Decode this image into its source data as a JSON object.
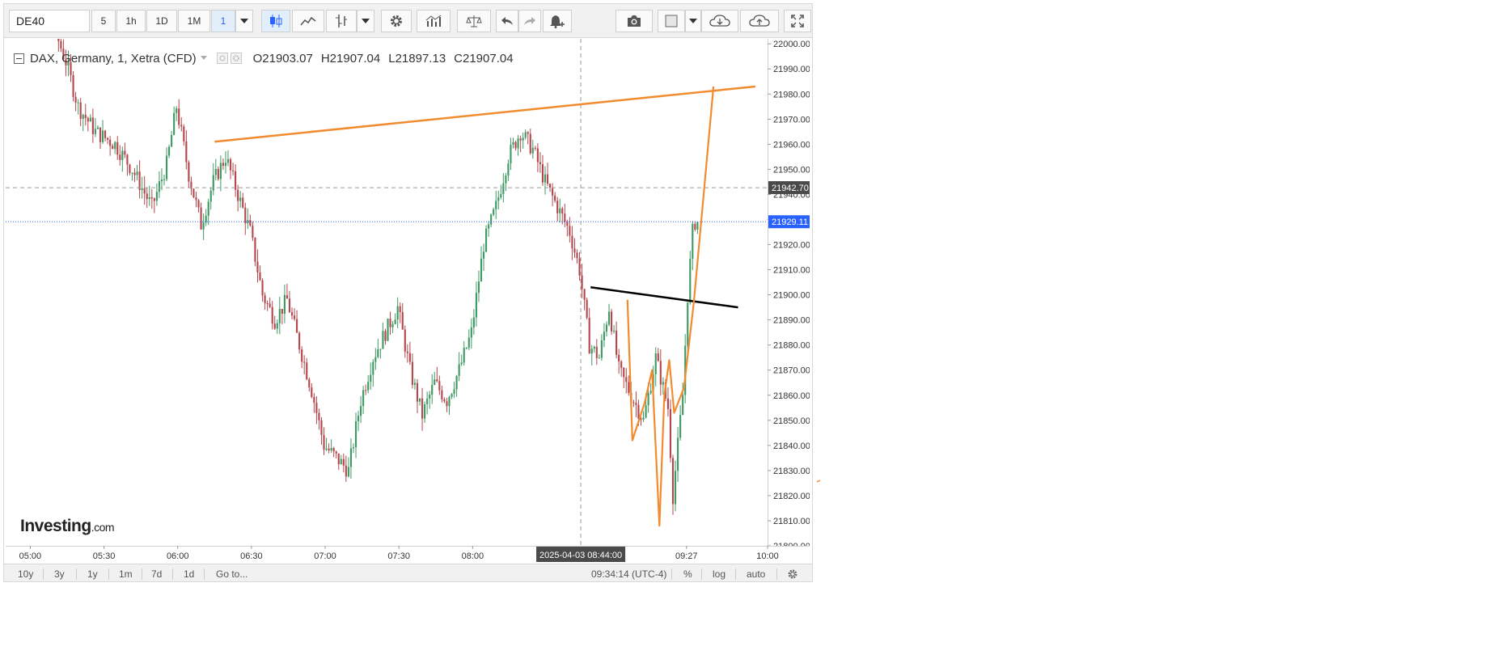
{
  "toolbar": {
    "symbol": "DE40",
    "intervals": [
      "5",
      "1h",
      "1D",
      "1M",
      "1"
    ],
    "active_interval": "1"
  },
  "legend": {
    "title": "DAX, Germany, 1, Xetra (CFD)",
    "open": "O21903.07",
    "high": "H21907.04",
    "low": "L21897.13",
    "close": "C21907.04"
  },
  "logo": {
    "name": "Investing",
    "suffix": ".com"
  },
  "bottom_bar": {
    "ranges": [
      "10y",
      "3y",
      "1y",
      "1m",
      "7d",
      "1d"
    ],
    "goto": "Go to...",
    "clock": "09:34:14 (UTC-4)",
    "percent": "%",
    "log": "log",
    "auto": "auto"
  },
  "colors": {
    "up": "#3d9a63",
    "down": "#b5464c",
    "trendline": "#f28a2e",
    "black_line": "#000000",
    "current_price": "#2962ff",
    "crosshair_label": "#4a4a4a"
  },
  "chart_data": {
    "type": "candlestick",
    "symbol": "DE40",
    "x_ticks": [
      "05:00",
      "05:30",
      "06:00",
      "06:30",
      "07:00",
      "07:30",
      "08:00",
      "09:27",
      "10:00"
    ],
    "y_ticks": [
      21800,
      21810,
      21820,
      21830,
      21840,
      21850,
      21860,
      21870,
      21880,
      21890,
      21900,
      21910,
      21920,
      21930,
      21940,
      21950,
      21960,
      21970,
      21980,
      21990,
      22000
    ],
    "ylim": [
      21800,
      22002
    ],
    "xlim": [
      "04:50",
      "10:00"
    ],
    "current_price": "21929.11",
    "crosshair_price": "21942.70",
    "crosshair_time": "2025-04-03 08:44:00",
    "price_path": [
      [
        "04:50",
        22015
      ],
      [
        "05:05",
        22020
      ],
      [
        "05:15",
        21993
      ],
      [
        "05:20",
        21975
      ],
      [
        "05:27",
        21965
      ],
      [
        "05:35",
        21960
      ],
      [
        "05:42",
        21950
      ],
      [
        "05:50",
        21935
      ],
      [
        "05:56",
        21952
      ],
      [
        "06:00",
        21975
      ],
      [
        "06:05",
        21948
      ],
      [
        "06:10",
        21928
      ],
      [
        "06:15",
        21945
      ],
      [
        "06:20",
        21955
      ],
      [
        "06:25",
        21940
      ],
      [
        "06:30",
        21925
      ],
      [
        "06:35",
        21900
      ],
      [
        "06:40",
        21890
      ],
      [
        "06:45",
        21898
      ],
      [
        "06:50",
        21880
      ],
      [
        "06:55",
        21862
      ],
      [
        "07:00",
        21840
      ],
      [
        "07:05",
        21835
      ],
      [
        "07:10",
        21830
      ],
      [
        "07:15",
        21858
      ],
      [
        "07:20",
        21875
      ],
      [
        "07:25",
        21885
      ],
      [
        "07:30",
        21895
      ],
      [
        "07:35",
        21870
      ],
      [
        "07:40",
        21852
      ],
      [
        "07:45",
        21865
      ],
      [
        "07:50",
        21858
      ],
      [
        "07:55",
        21870
      ],
      [
        "08:00",
        21885
      ],
      [
        "08:05",
        21920
      ],
      [
        "08:10",
        21935
      ],
      [
        "08:15",
        21955
      ],
      [
        "08:20",
        21965
      ],
      [
        "08:25",
        21958
      ],
      [
        "08:30",
        21945
      ],
      [
        "08:35",
        21935
      ],
      [
        "08:40",
        21925
      ],
      [
        "08:44",
        21910
      ],
      [
        "08:48",
        21880
      ],
      [
        "08:52",
        21875
      ],
      [
        "08:56",
        21895
      ],
      [
        "09:00",
        21870
      ],
      [
        "09:05",
        21860
      ],
      [
        "09:10",
        21850
      ],
      [
        "09:15",
        21875
      ],
      [
        "09:20",
        21855
      ],
      [
        "09:22",
        21820
      ],
      [
        "09:24",
        21840
      ],
      [
        "09:26",
        21860
      ],
      [
        "09:28",
        21900
      ],
      [
        "09:30",
        21925
      ],
      [
        "09:31",
        21929
      ]
    ],
    "annotations": [
      {
        "type": "trendline",
        "color": "orange",
        "points": [
          [
            "06:15",
            21961
          ],
          [
            "09:55",
            21983
          ]
        ]
      },
      {
        "type": "trendline",
        "color": "black",
        "points": [
          [
            "08:48",
            21903
          ],
          [
            "09:48",
            21895
          ]
        ]
      },
      {
        "type": "polyline",
        "color": "orange",
        "points": [
          [
            "09:03",
            21898
          ],
          [
            "09:05",
            21842
          ],
          [
            "09:10",
            21857
          ],
          [
            "09:13",
            21870
          ],
          [
            "09:16",
            21808
          ],
          [
            "09:18",
            21860
          ],
          [
            "09:20",
            21874
          ],
          [
            "09:22",
            21853
          ],
          [
            "09:26",
            21863
          ],
          [
            "09:30",
            21897
          ],
          [
            "09:38",
            21983
          ]
        ]
      }
    ]
  }
}
